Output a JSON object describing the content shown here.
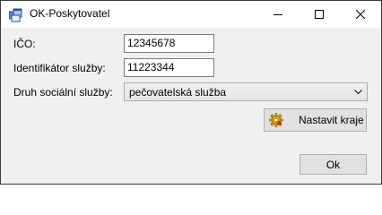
{
  "window": {
    "title": "OK-Poskytovatel",
    "icon": "app-window-icon",
    "controls": [
      "minimize-icon",
      "maximize-icon",
      "close-icon"
    ]
  },
  "form": {
    "ico_label": "IČO:",
    "ico_value": "12345678",
    "service_id_label": "Identifikátor služby:",
    "service_id_value": "11223344",
    "service_type_label": "Druh sociální služby:",
    "service_type_selected": "pečovatelská služba"
  },
  "buttons": {
    "set_regions_label": "Nastavit kraje",
    "set_regions_icon": "gear-icon",
    "ok_label": "Ok"
  },
  "colors": {
    "window_bg": "#f0f0f0",
    "titlebar_bg": "#ffffff",
    "button_bg": "#e1e1e1",
    "border": "#7a7a7a"
  }
}
